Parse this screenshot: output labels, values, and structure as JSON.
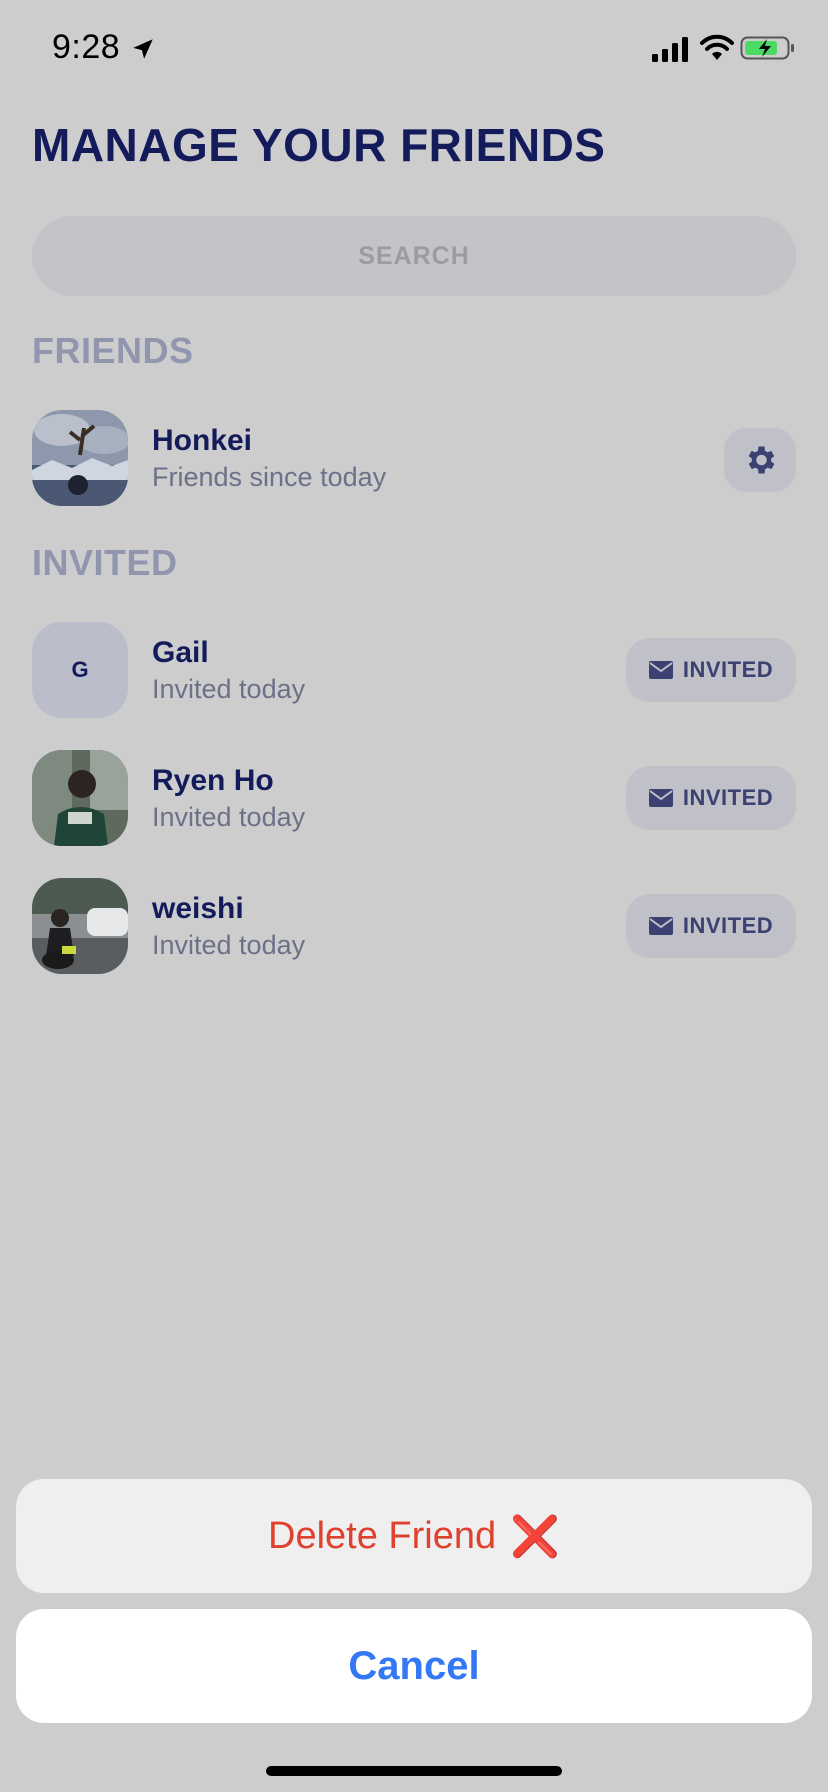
{
  "status_bar": {
    "time": "9:28"
  },
  "header": {
    "title": "MANAGE YOUR FRIENDS"
  },
  "search": {
    "placeholder": "SEARCH"
  },
  "friends_section": {
    "label": "FRIENDS",
    "items": [
      {
        "name": "Honkei",
        "subtitle": "Friends since today"
      }
    ]
  },
  "invited_section": {
    "label": "INVITED",
    "items": [
      {
        "name": "Gail",
        "initial": "G",
        "subtitle": "Invited today",
        "button": "INVITED"
      },
      {
        "name": "Ryen Ho",
        "subtitle": "Invited today",
        "button": "INVITED"
      },
      {
        "name": "weishi",
        "subtitle": "Invited today",
        "button": "INVITED"
      }
    ]
  },
  "action_sheet": {
    "delete_label": "Delete Friend",
    "delete_icon": "❌",
    "cancel_label": "Cancel"
  },
  "colors": {
    "background": "#cdcdce",
    "title": "#131b5b",
    "danger": "#e0402e",
    "link": "#3478f6"
  }
}
